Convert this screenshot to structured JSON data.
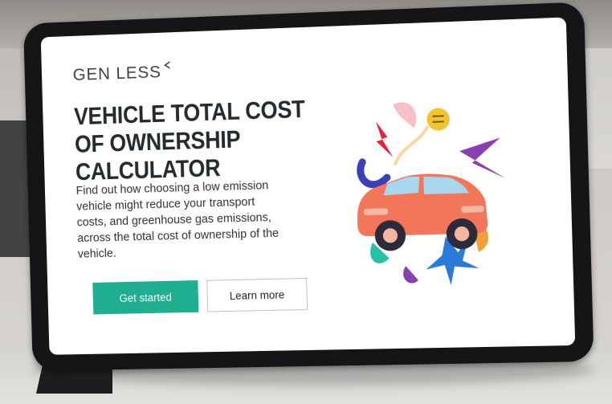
{
  "app": {
    "logo_text": "GEN LESS",
    "title": "VEHICLE TOTAL COST OF OWNERSHIP CALCULATOR",
    "description": "Find out how choosing a low emission vehicle might reduce your transport costs, and greenhouse gas emissions, across the total cost of ownership of the vehicle."
  },
  "buttons": {
    "primary_label": "Get started",
    "secondary_label": "Learn more"
  },
  "colors": {
    "accent": "#1fae8f",
    "title": "#242b2e",
    "car": "#f2765a"
  },
  "illustration": {
    "icon": "electric-car-illustration"
  }
}
